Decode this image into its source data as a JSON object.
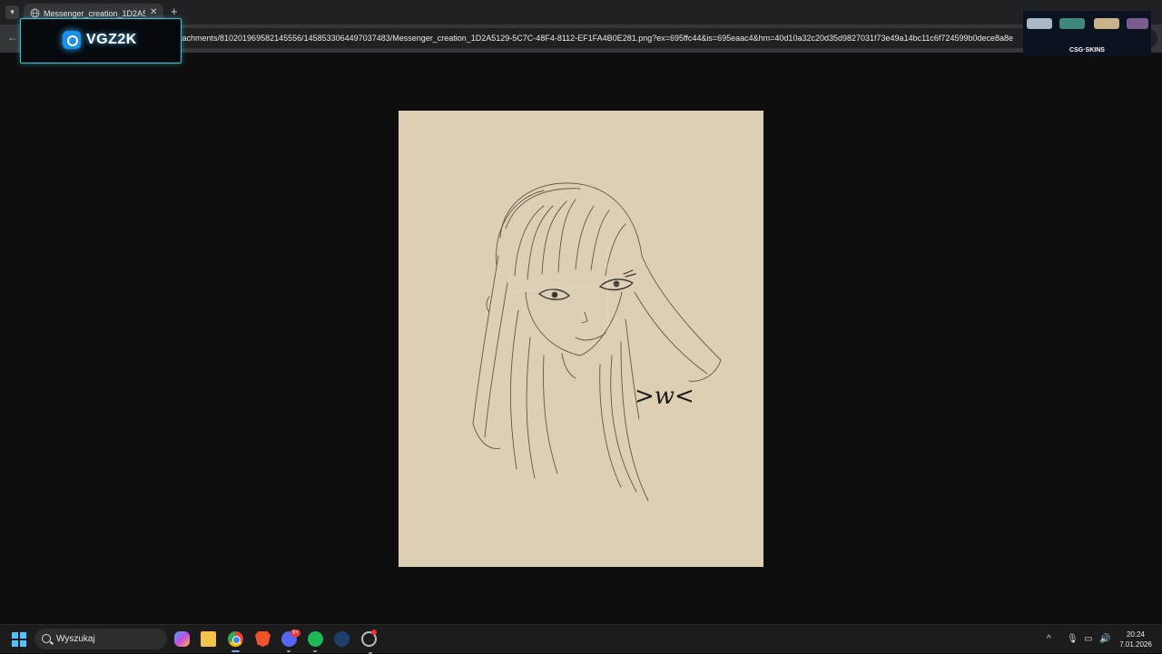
{
  "browser": {
    "tab_title": "Messenger_creation_1D2A5129",
    "url": "tachments/810201969582145556/1458533064497037483/Messenger_creation_1D2A5129-5C7C-48F4-8112-EF1FA4B0E281.png?ex=695ffc44&is=695eaac4&hm=40d10a32c20d35d9827031f73e49a14bc11c6f724599b0dece8a8e"
  },
  "overlay": {
    "logo_text": "VGZ2K",
    "ad_text": "CSG·SKINS"
  },
  "artwork": {
    "caption": ">w<"
  },
  "taskbar": {
    "search_placeholder": "Wyszukaj",
    "discord_badge": "9+",
    "time": "20:24",
    "date": "7.01.2026"
  },
  "colors": {
    "canvas_bg": "#dccfb4",
    "accent": "#2fc7d8"
  }
}
